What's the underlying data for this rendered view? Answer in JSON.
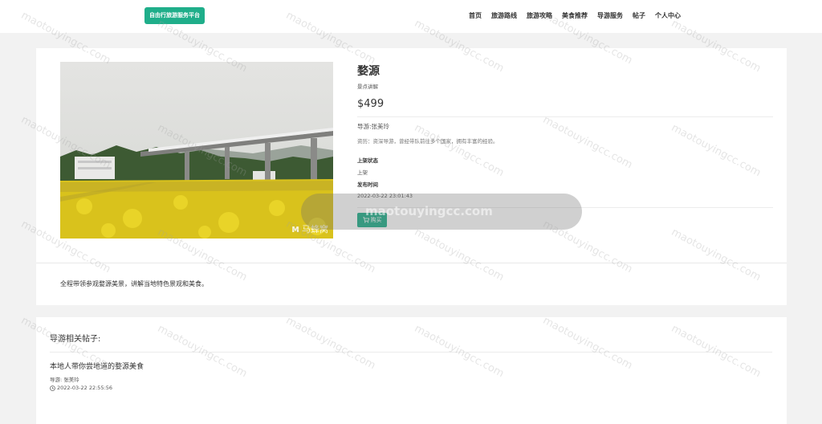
{
  "header": {
    "logo_label": "自由行旅游服务平台",
    "nav": [
      "首页",
      "旅游路线",
      "旅游攻略",
      "美食推荐",
      "导游服务",
      "帖子",
      "个人中心"
    ]
  },
  "product": {
    "title": "婺源",
    "subtitle": "景点讲解",
    "price": "$499",
    "guide": "导游:张美玲",
    "bio": "资历：资深导游，曾经带队前往多个国家，拥有丰富的经验。",
    "status_label": "上架状态",
    "status_value": "上架",
    "publish_label": "发布时间",
    "publish_value": "2022-03-22 23:01:43",
    "buy_label": "购买",
    "image_watermark": "马蜂窝"
  },
  "description": "全程带领参观婺源美景，讲解当地特色景观和美食。",
  "related": {
    "heading": "导游相关帖子:",
    "posts": [
      {
        "title": "本地人带你尝地道的婺源美食",
        "guide": "导游: 张美玲",
        "date": "2022-03-22 22:55:56"
      }
    ]
  },
  "overlay": {
    "text": "maotouyingcc.com"
  },
  "watermark": {
    "text": "maotouyingcc.com"
  },
  "colors": {
    "accent": "#1fae8a",
    "page_bg": "#f2f2f2"
  },
  "icons": {
    "cart": "cart-icon",
    "clock": "clock-icon"
  }
}
